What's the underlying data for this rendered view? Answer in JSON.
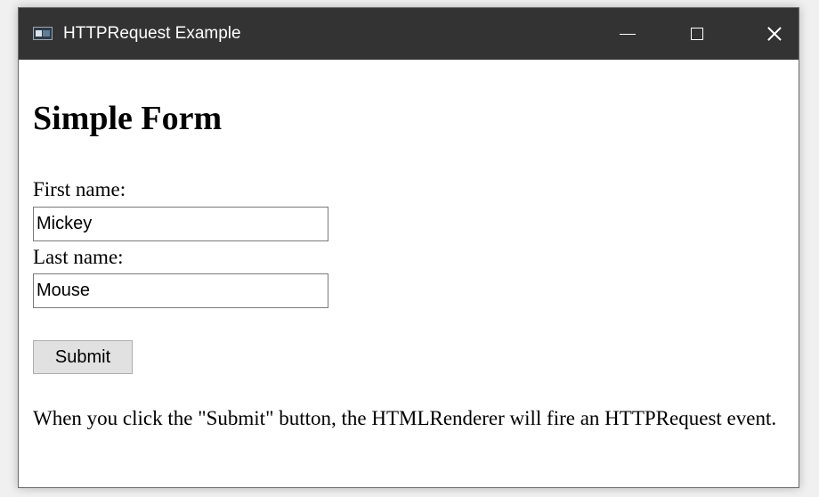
{
  "window": {
    "title": "HTTPRequest Example",
    "controls": {
      "minimize": "minimize-icon",
      "maximize": "maximize-icon",
      "close": "close-icon"
    }
  },
  "form": {
    "heading": "Simple Form",
    "first_name_label": "First name:",
    "first_name_value": "Mickey",
    "last_name_label": "Last name:",
    "last_name_value": "Mouse",
    "submit_label": "Submit"
  },
  "description": "When you click the \"Submit\" button, the HTMLRenderer will fire an HTTPRequest event.",
  "colors": {
    "titlebar": "#333333",
    "window_background": "#ffffff",
    "button_background": "#e1e1e1",
    "input_border": "#7a7a7a"
  }
}
